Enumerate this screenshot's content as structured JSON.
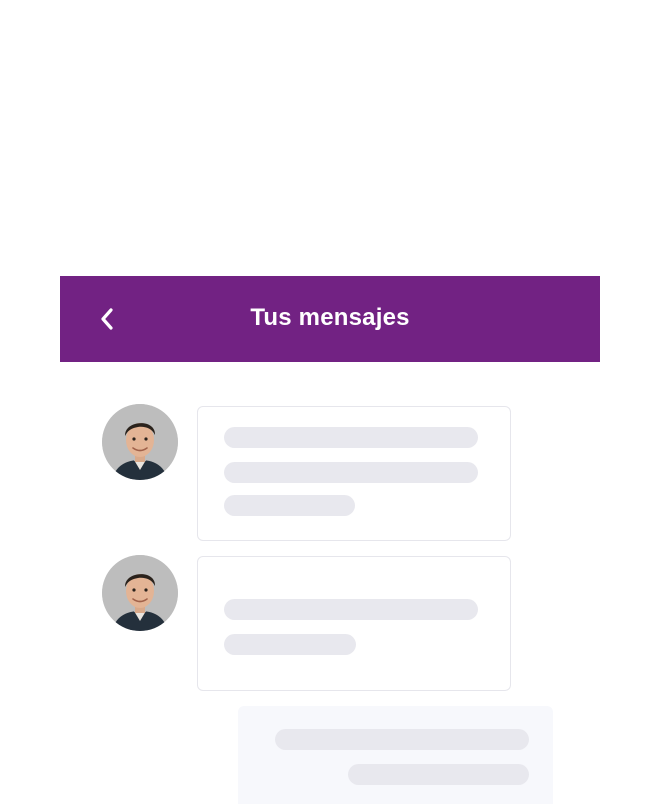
{
  "header": {
    "title": "Tus mensajes",
    "back_icon": "chevron-left-icon",
    "background_color": "#722283",
    "text_color": "#ffffff"
  },
  "messages": [
    {
      "sender": "contact",
      "avatar_icon": "person-photo-avatar",
      "skeleton_lines": 3
    },
    {
      "sender": "contact",
      "avatar_icon": "person-photo-avatar",
      "skeleton_lines": 2
    },
    {
      "sender": "self",
      "skeleton_lines": 2
    }
  ],
  "colors": {
    "skeleton": "#e8e8ee",
    "card_border": "#e6e6ec",
    "outgoing_card": "#f7f8fc"
  }
}
